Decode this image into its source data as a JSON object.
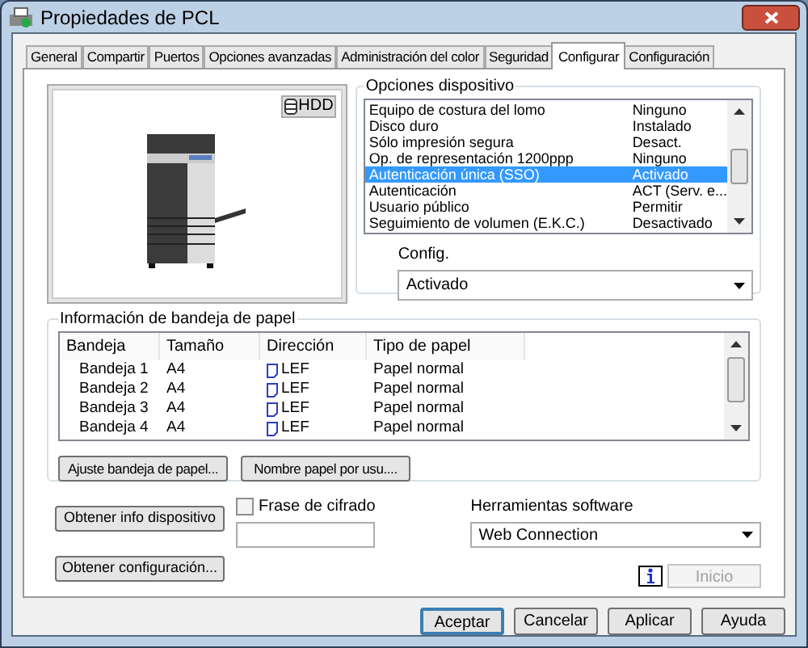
{
  "window": {
    "title": "Propiedades de PCL"
  },
  "tabs": [
    {
      "label": "General",
      "selected": false
    },
    {
      "label": "Compartir",
      "selected": false
    },
    {
      "label": "Puertos",
      "selected": false
    },
    {
      "label": "Opciones avanzadas",
      "selected": false
    },
    {
      "label": "Administración del color",
      "selected": false
    },
    {
      "label": "Seguridad",
      "selected": false
    },
    {
      "label": "Configurar",
      "selected": true
    },
    {
      "label": "Configuración",
      "selected": false
    }
  ],
  "preview": {
    "badge": "HDD"
  },
  "device_options": {
    "title": "Opciones dispositivo",
    "items": [
      {
        "name": "Equipo de costura del lomo",
        "value": "Ninguno",
        "selected": false
      },
      {
        "name": "Disco duro",
        "value": "Instalado",
        "selected": false
      },
      {
        "name": "Sólo impresión segura",
        "value": "Desact.",
        "selected": false
      },
      {
        "name": "Op. de representación 1200ppp",
        "value": "Ninguno",
        "selected": false
      },
      {
        "name": "Autenticación única (SSO)",
        "value": "Activado",
        "selected": true
      },
      {
        "name": "Autenticación",
        "value": "ACT (Serv. e...",
        "selected": false
      },
      {
        "name": "Usuario público",
        "value": "Permitir",
        "selected": false
      },
      {
        "name": "Seguimiento de volumen (E.K.C.)",
        "value": "Desactivado",
        "selected": false
      }
    ]
  },
  "config": {
    "label": "Config.",
    "value": "Activado"
  },
  "tray_info": {
    "title": "Información de bandeja de papel",
    "columns": [
      "Bandeja",
      "Tamaño",
      "Dirección",
      "Tipo de papel"
    ],
    "rows": [
      [
        "Bandeja 1",
        "A4",
        "LEF",
        "Papel normal"
      ],
      [
        "Bandeja 2",
        "A4",
        "LEF",
        "Papel normal"
      ],
      [
        "Bandeja 3",
        "A4",
        "LEF",
        "Papel normal"
      ],
      [
        "Bandeja 4",
        "A4",
        "LEF",
        "Papel normal"
      ]
    ],
    "buttons": [
      "Ajuste bandeja de papel...",
      "Nombre papel por usu...."
    ]
  },
  "get_info_button": "Obtener info dispositivo",
  "get_config_button": "Obtener configuración...",
  "passphrase": {
    "label": "Frase de cifrado",
    "checked": false
  },
  "software_tools": {
    "label": "Herramientas software",
    "value": "Web Connection",
    "start_button": "Inicio",
    "start_disabled": true
  },
  "dialog_buttons": [
    {
      "label": "Aceptar",
      "default": true
    },
    {
      "label": "Cancelar",
      "default": false
    },
    {
      "label": "Aplicar",
      "default": false
    },
    {
      "label": "Ayuda",
      "default": false
    }
  ]
}
